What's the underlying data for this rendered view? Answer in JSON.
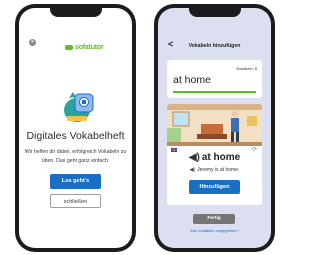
{
  "left_screen": {
    "close_icon": "×",
    "logo_text": "sofatutor",
    "title": "Digitales Vokabelheft",
    "description": "Wir helfen dir dabei, erfolgreich Vokabeln zu üben. Das geht ganz einfach:",
    "primary_button": "Los geht's",
    "secondary_button": "schließen"
  },
  "right_screen": {
    "back_icon": "<",
    "header_title": "Vokabeln hinzufügen",
    "input": {
      "counter": "Vokabeln: 8",
      "value": "at home"
    },
    "card": {
      "word": "at home",
      "sentence": "Jeremy is at home.",
      "add_button": "Hinzufügen"
    },
    "done_button": "Fertig",
    "all_vocab_link": "Alle Vokabeln eingegeben?"
  },
  "colors": {
    "brand_green": "#5cbf2a",
    "primary_blue": "#1a6fc4",
    "right_background": "#dcdff0"
  }
}
